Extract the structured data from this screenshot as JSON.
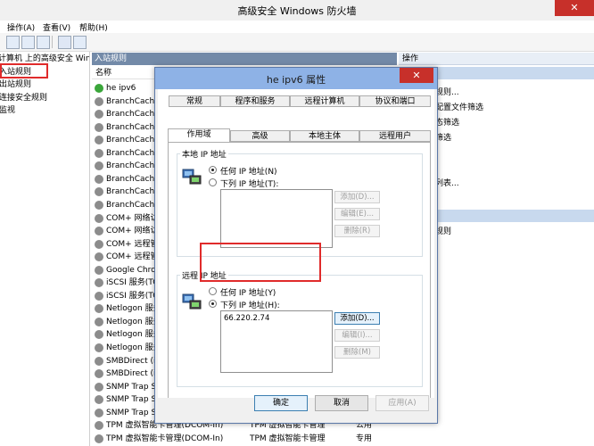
{
  "window": {
    "title": "高级安全 Windows 防火墙",
    "close": "✕"
  },
  "menu": {
    "items": [
      "操作(A)",
      "查看(V)",
      "帮助(H)"
    ]
  },
  "tree": {
    "items": [
      "计算机 上的高级安全 Win",
      "入站规则",
      "出站规则",
      "连接安全规则",
      "监视"
    ]
  },
  "middle": {
    "header": "入站规则",
    "column_name": "名称",
    "rows": [
      {
        "name": "he ipv6",
        "group": "",
        "profile": "",
        "enabled": true
      },
      {
        "name": "BranchCache",
        "group": "",
        "profile": ""
      },
      {
        "name": "BranchCache",
        "group": "",
        "profile": ""
      },
      {
        "name": "BranchCache",
        "group": "",
        "profile": ""
      },
      {
        "name": "BranchCache",
        "group": "",
        "profile": ""
      },
      {
        "name": "BranchCache",
        "group": "",
        "profile": ""
      },
      {
        "name": "BranchCache",
        "group": "",
        "profile": ""
      },
      {
        "name": "BranchCache",
        "group": "",
        "profile": ""
      },
      {
        "name": "BranchCache",
        "group": "",
        "profile": ""
      },
      {
        "name": "BranchCache",
        "group": "",
        "profile": ""
      },
      {
        "name": "COM+ 网络访",
        "group": "",
        "profile": ""
      },
      {
        "name": "COM+ 网络访",
        "group": "",
        "profile": ""
      },
      {
        "name": "COM+ 远程管",
        "group": "",
        "profile": ""
      },
      {
        "name": "COM+ 远程管",
        "group": "",
        "profile": ""
      },
      {
        "name": "Google Chron",
        "group": "",
        "profile": ""
      },
      {
        "name": "iSCSI 服务(TCF",
        "group": "",
        "profile": ""
      },
      {
        "name": "iSCSI 服务(TCF",
        "group": "",
        "profile": ""
      },
      {
        "name": "Netlogon 服务",
        "group": "",
        "profile": ""
      },
      {
        "name": "Netlogon 服务",
        "group": "",
        "profile": ""
      },
      {
        "name": "Netlogon 服务",
        "group": "",
        "profile": ""
      },
      {
        "name": "Netlogon 服务",
        "group": "",
        "profile": ""
      },
      {
        "name": "SMBDirect (iV",
        "group": "",
        "profile": ""
      },
      {
        "name": "SMBDirect (iV",
        "group": "",
        "profile": ""
      },
      {
        "name": "SNMP Trap S",
        "group": "",
        "profile": ""
      },
      {
        "name": "SNMP Trap S",
        "group": "",
        "profile": ""
      },
      {
        "name": "SNMP Trap S",
        "group": "",
        "profile": ""
      },
      {
        "name": "TPM 虚拟智能卡管理(DCOM-In)",
        "group": "TPM 虚拟智能卡管理",
        "profile": "公用"
      },
      {
        "name": "TPM 虚拟智能卡管理(DCOM-In)",
        "group": "TPM 虚拟智能卡管理",
        "profile": "专用"
      }
    ]
  },
  "actions": {
    "header": "操作",
    "items": [
      "规则...",
      "配置文件筛选",
      "态筛选",
      "筛选",
      "列表...",
      "规则"
    ]
  },
  "dialog": {
    "title": "he ipv6 属性",
    "close": "✕",
    "tabs_row1": [
      "常规",
      "程序和服务",
      "远程计算机",
      "协议和端口"
    ],
    "tabs_row2": [
      "作用域",
      "高级",
      "本地主体",
      "远程用户"
    ],
    "local": {
      "label": "本地 IP 地址",
      "any": "任何 IP 地址(N)",
      "these": "下列 IP 地址(T):",
      "add": "添加(D)...",
      "edit": "编辑(E)...",
      "remove": "删除(R)"
    },
    "remote": {
      "label": "远程 IP 地址",
      "any": "任何 IP 地址(Y)",
      "these": "下列 IP 地址(H):",
      "address": "66.220.2.74",
      "add": "添加(D)...",
      "edit": "编辑(I)...",
      "remove": "删除(M)"
    },
    "ok": "确定",
    "cancel": "取消",
    "apply": "应用(A)"
  }
}
